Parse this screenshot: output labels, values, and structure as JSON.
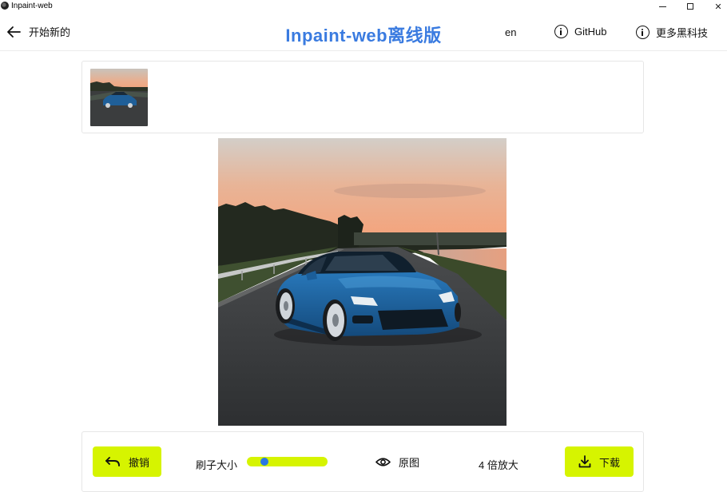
{
  "window": {
    "title": "Inpaint-web",
    "minimize_glyph": "",
    "close_glyph": "✕"
  },
  "header": {
    "back_label": "开始新的",
    "brand_title": "Inpaint-web离线版",
    "language": "en",
    "github_label": "GitHub",
    "more_label": "更多黑科技"
  },
  "toolbar": {
    "undo_label": "撤销",
    "brush_label": "刷子大小",
    "brush_size_fraction": 0.18,
    "original_label": "原图",
    "zoom_label": "4 倍放大",
    "download_label": "下载"
  },
  "colors": {
    "accent": "#d6f400",
    "brand": "#3a7be0",
    "slider_thumb": "#2a78e4"
  },
  "icons": {
    "back": "arrow-left-icon",
    "info": "info-circle-icon",
    "undo": "undo-arrow-icon",
    "eye": "eye-icon",
    "download": "download-icon"
  }
}
